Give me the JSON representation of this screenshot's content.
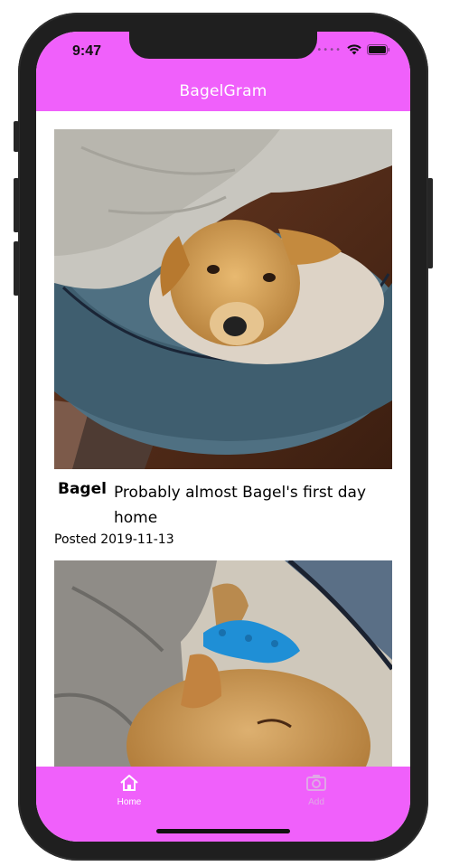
{
  "status_bar": {
    "time": "9:47",
    "signal_icon": "signal-dots-icon",
    "wifi_icon": "wifi-icon",
    "battery_icon": "battery-icon"
  },
  "header": {
    "title": "BagelGram"
  },
  "posts": [
    {
      "username": "Bagel",
      "caption": "Probably almost Bagel's first day home",
      "date": "Posted 2019-11-13",
      "image": "puppy-in-dog-bed-photo"
    },
    {
      "username": "",
      "caption": "",
      "date": "",
      "image": "puppy-sleeping-with-blue-toy-photo"
    }
  ],
  "tabs": [
    {
      "label": "Home",
      "icon": "home-icon",
      "active": true
    },
    {
      "label": "Add",
      "icon": "camera-icon",
      "active": false
    }
  ],
  "colors": {
    "accent": "#f060fb",
    "active_tab": "#ffffff",
    "inactive_tab": "#e0a7e6"
  }
}
